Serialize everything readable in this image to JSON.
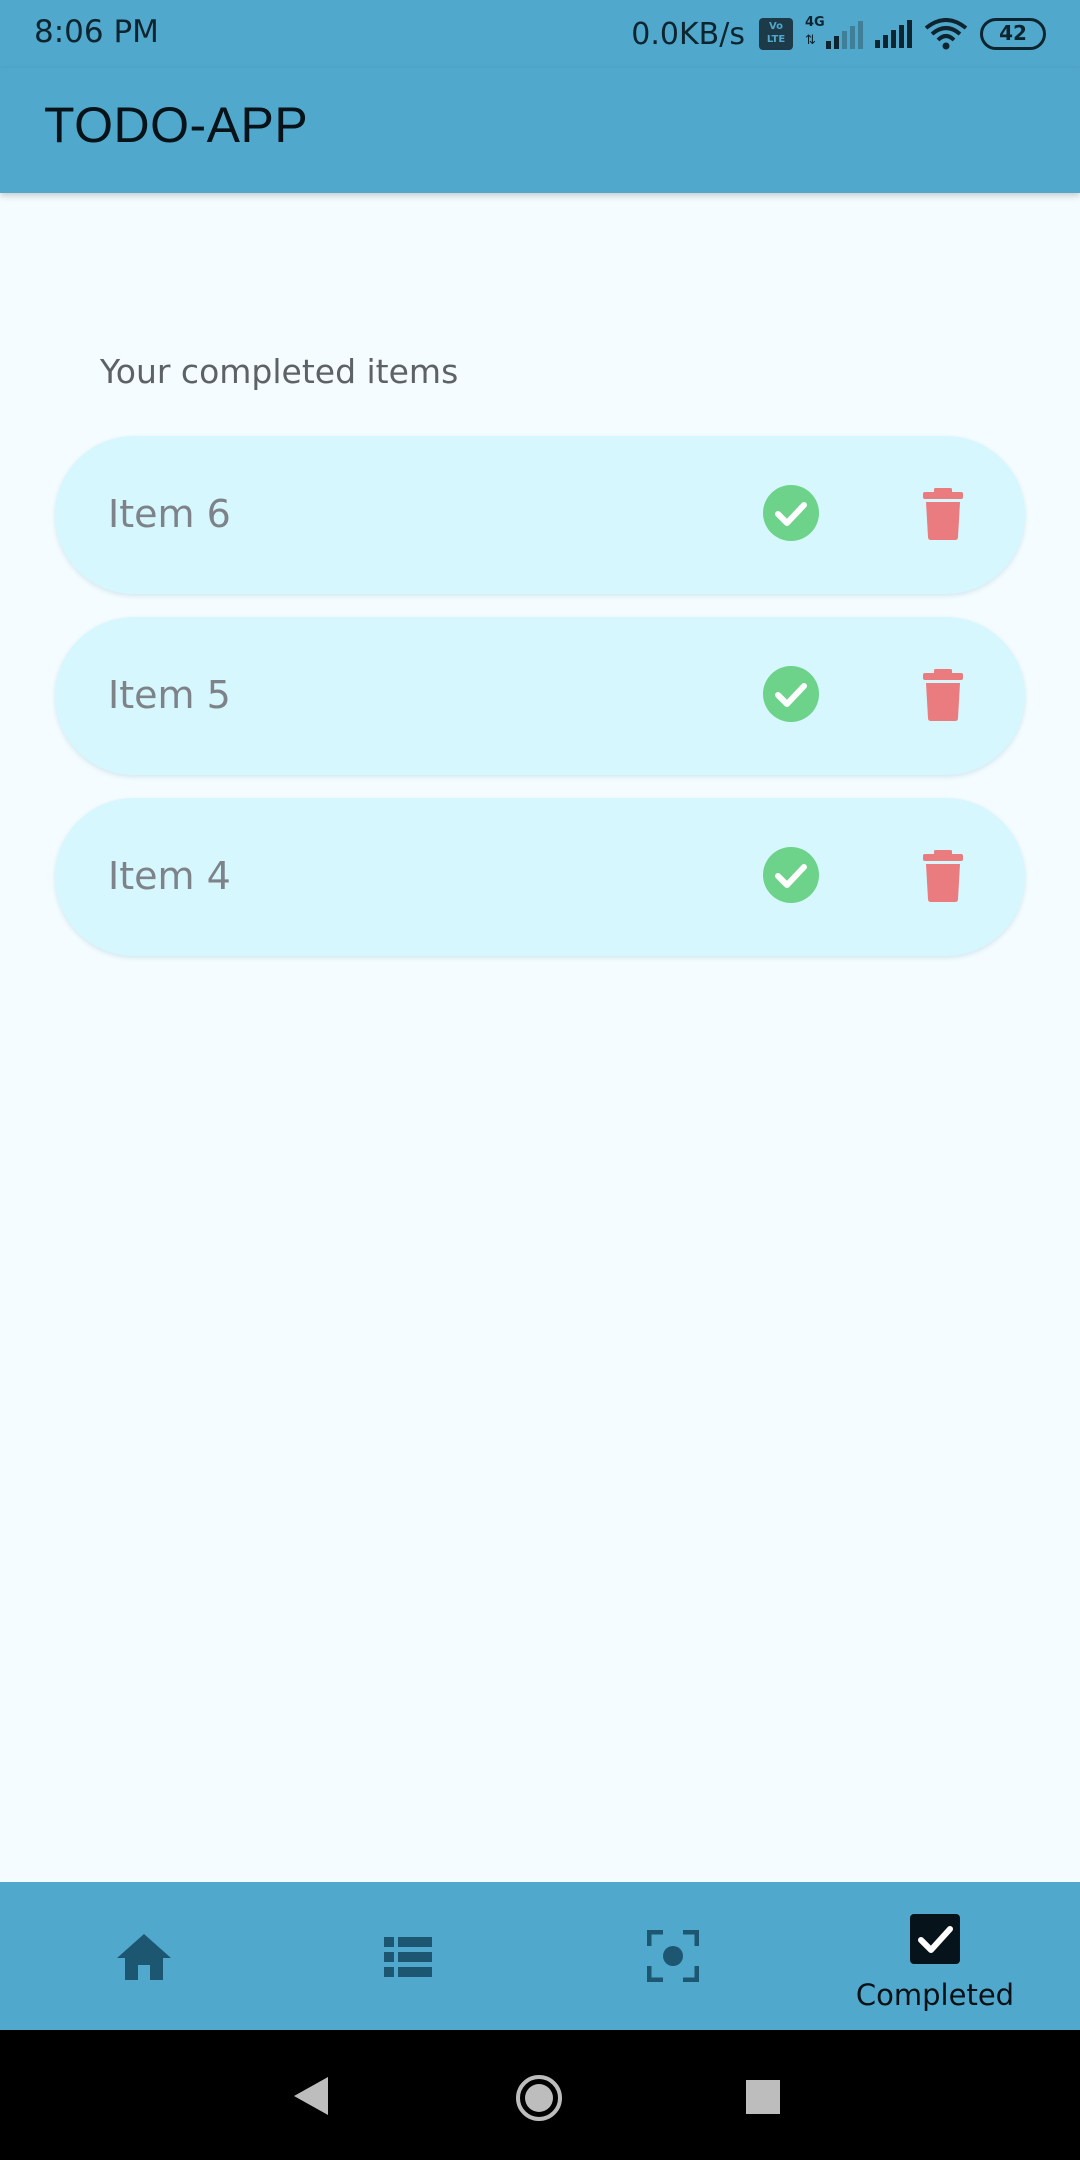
{
  "status_bar": {
    "time": "8:06 PM",
    "net_speed": "0.0KB/s",
    "volte_line1": "Vo",
    "volte_line2": "LTE",
    "network_type": "4G",
    "battery_level": "42"
  },
  "app_bar": {
    "title": "TODO-APP"
  },
  "main": {
    "heading": "Your completed items",
    "items": [
      {
        "label": "Item 6"
      },
      {
        "label": "Item 5"
      },
      {
        "label": "Item 4"
      }
    ]
  },
  "bottom_nav": {
    "items": [
      {
        "icon": "home-icon",
        "label": ""
      },
      {
        "icon": "list-icon",
        "label": ""
      },
      {
        "icon": "focus-icon",
        "label": ""
      },
      {
        "icon": "checkbox-icon",
        "label": "Completed",
        "active": true
      }
    ]
  },
  "colors": {
    "primary": "#50a8cc",
    "background": "#f4fcff",
    "card": "#d6f7fd",
    "check": "#6dd28a",
    "delete": "#ea7b7f",
    "nav_icon": "#1d5670"
  }
}
